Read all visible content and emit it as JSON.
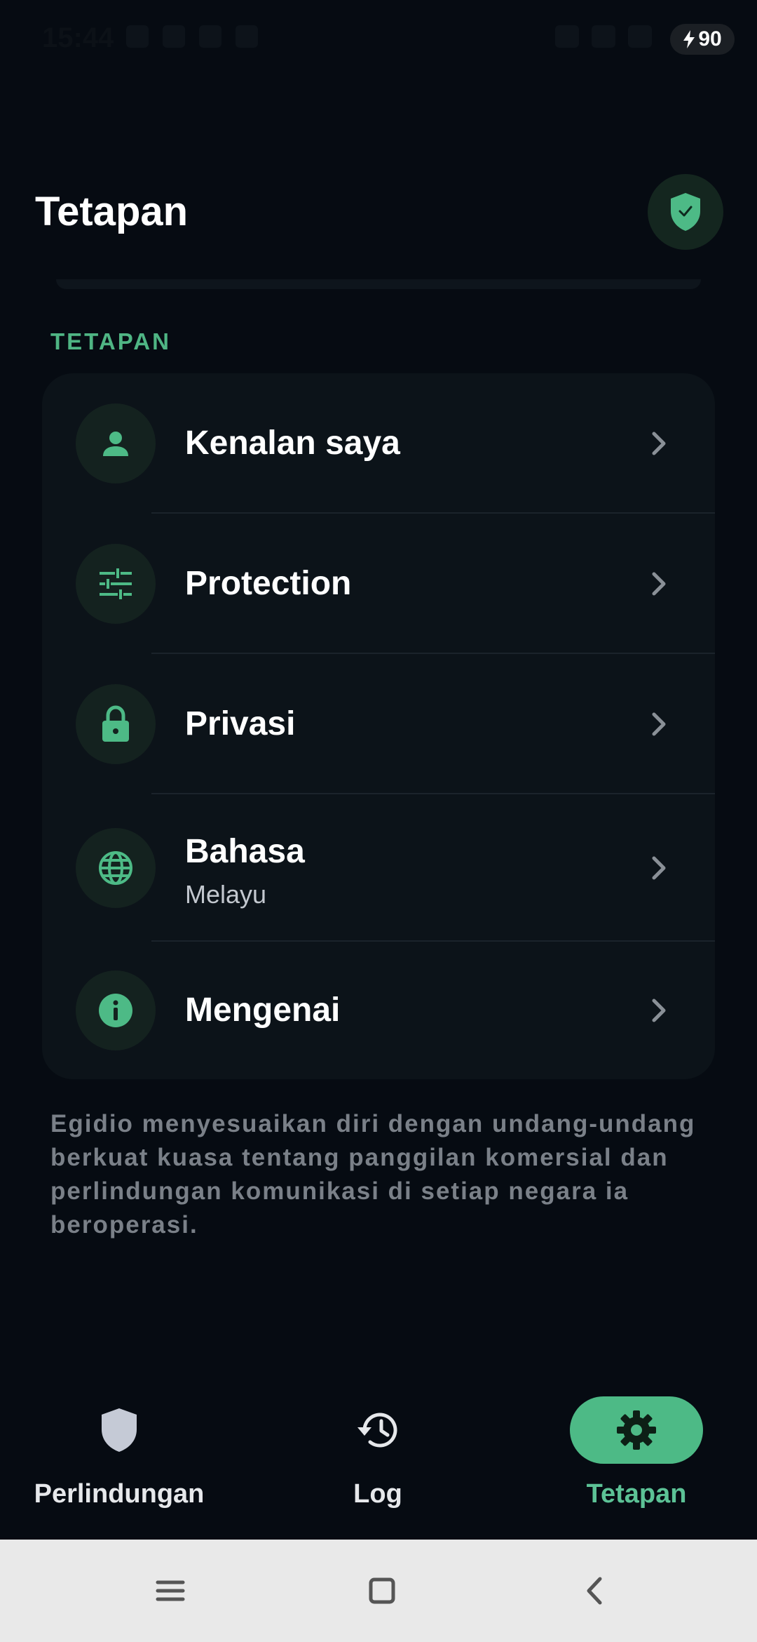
{
  "status_bar": {
    "time": "15:44",
    "battery": "90"
  },
  "header": {
    "title": "Tetapan"
  },
  "section": {
    "label": "TETAPAN"
  },
  "settings": {
    "items": [
      {
        "label": "Kenalan saya",
        "icon": "person-icon"
      },
      {
        "label": "Protection",
        "icon": "sliders-icon"
      },
      {
        "label": "Privasi",
        "icon": "lock-icon"
      },
      {
        "label": "Bahasa",
        "sublabel": "Melayu",
        "icon": "globe-icon"
      },
      {
        "label": "Mengenai",
        "icon": "info-icon"
      }
    ]
  },
  "footnote": "Egidio menyesuaikan diri dengan undang-undang berkuat kuasa tentang panggilan komersial dan perlindungan komunikasi di setiap negara ia beroperasi.",
  "bottom_nav": {
    "items": [
      {
        "label": "Perlindungan",
        "icon": "shield-icon",
        "active": false
      },
      {
        "label": "Log",
        "icon": "history-icon",
        "active": false
      },
      {
        "label": "Tetapan",
        "icon": "gear-icon",
        "active": true
      }
    ]
  },
  "colors": {
    "accent": "#4dba86",
    "background": "#060b12",
    "card": "#0c1319"
  }
}
